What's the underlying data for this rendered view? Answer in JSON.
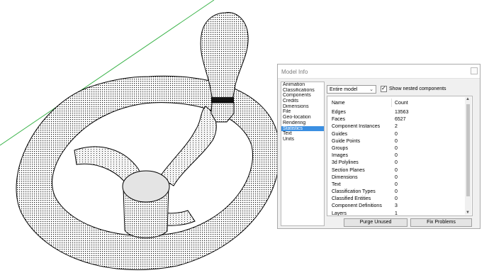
{
  "viewport": {
    "object": "handwheel-model"
  },
  "dialog": {
    "title": "Model Info",
    "nav_items": [
      {
        "label": "Animation",
        "selected": false
      },
      {
        "label": "Classifications",
        "selected": false
      },
      {
        "label": "Components",
        "selected": false
      },
      {
        "label": "Credits",
        "selected": false
      },
      {
        "label": "Dimensions",
        "selected": false
      },
      {
        "label": "File",
        "selected": false
      },
      {
        "label": "Geo-location",
        "selected": false
      },
      {
        "label": "Rendering",
        "selected": false
      },
      {
        "label": "Statistics",
        "selected": true
      },
      {
        "label": "Text",
        "selected": false
      },
      {
        "label": "Units",
        "selected": false
      }
    ],
    "scope": {
      "value": "Entire model"
    },
    "show_nested": {
      "label": "Show nested components",
      "checked": true
    },
    "table": {
      "headers": {
        "name": "Name",
        "count": "Count"
      },
      "rows": [
        {
          "name": "Edges",
          "count": "13563"
        },
        {
          "name": "Faces",
          "count": "6527"
        },
        {
          "name": "Component Instances",
          "count": "2"
        },
        {
          "name": "Guides",
          "count": "0"
        },
        {
          "name": "Guide Points",
          "count": "0"
        },
        {
          "name": "Groups",
          "count": "0"
        },
        {
          "name": "Images",
          "count": "0"
        },
        {
          "name": "3d Polylines",
          "count": "0"
        },
        {
          "name": "Section Planes",
          "count": "0"
        },
        {
          "name": "Dimensions",
          "count": "0"
        },
        {
          "name": "Text",
          "count": "0"
        },
        {
          "name": "Classification Types",
          "count": "0"
        },
        {
          "name": "Classified Entities",
          "count": "0"
        },
        {
          "name": "Component Definitions",
          "count": "3"
        },
        {
          "name": "Layers",
          "count": "1"
        }
      ]
    },
    "buttons": {
      "purge": "Purge Unused",
      "fix": "Fix Problems"
    }
  },
  "colors": {
    "selection": "#3b8fe2",
    "axis_green": "#3cb44b"
  }
}
